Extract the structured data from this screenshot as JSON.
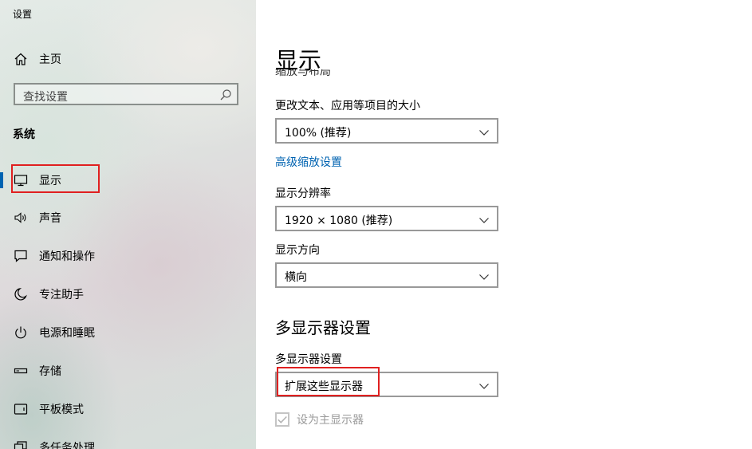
{
  "window": {
    "title": "设置"
  },
  "sidebar": {
    "home_label": "主页",
    "search_placeholder": "查找设置",
    "section_title": "系统",
    "items": [
      {
        "label": "显示",
        "icon": "monitor-icon",
        "selected": true
      },
      {
        "label": "声音",
        "icon": "speaker-icon"
      },
      {
        "label": "通知和操作",
        "icon": "notification-icon"
      },
      {
        "label": "专注助手",
        "icon": "moon-icon"
      },
      {
        "label": "电源和睡眠",
        "icon": "power-icon"
      },
      {
        "label": "存储",
        "icon": "storage-icon"
      },
      {
        "label": "平板模式",
        "icon": "tablet-icon"
      },
      {
        "label": "多任务处理",
        "icon": "multitask-icon"
      }
    ]
  },
  "main": {
    "title": "显示",
    "clipped_text": "缩放与布局",
    "scale": {
      "label": "更改文本、应用等项目的大小",
      "value": "100% (推荐)"
    },
    "advanced_scaling_link": "高级缩放设置",
    "resolution": {
      "label": "显示分辨率",
      "value": "1920 × 1080 (推荐)"
    },
    "orientation": {
      "label": "显示方向",
      "value": "横向"
    },
    "multi_display": {
      "heading": "多显示器设置",
      "label": "多显示器设置",
      "value": "扩展这些显示器",
      "primary_checkbox_label": "设为主显示器",
      "primary_checked": true,
      "primary_disabled": true
    }
  },
  "colors": {
    "accent": "#0063b1",
    "highlight": "#e02020"
  }
}
